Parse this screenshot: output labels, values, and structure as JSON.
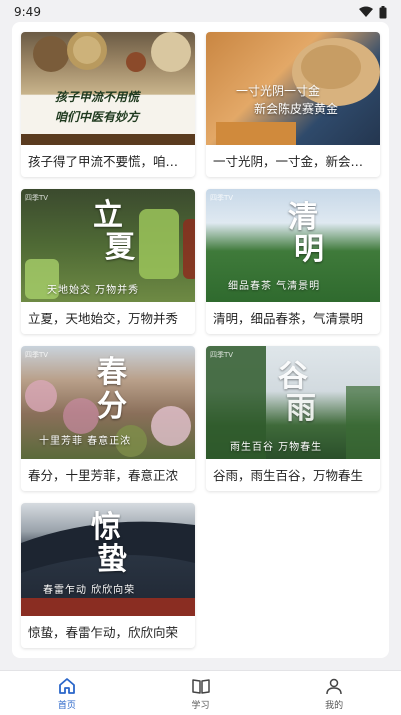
{
  "status": {
    "time": "9:49"
  },
  "cards": [
    {
      "title": "孩子得了甲流不要慌，咱们中医有妙方",
      "banner_line1": "孩子甲流不用慌",
      "banner_line2": "咱们中医有妙方"
    },
    {
      "title": "一寸光阴，一寸金，新会陈皮赛黄金",
      "banner_line1": "一寸光阴一寸金",
      "banner_line2": "新会陈皮赛黄金"
    },
    {
      "title": "立夏，天地始交，万物并秀",
      "char1": "立",
      "char2": "夏",
      "caption": "天地始交  万物并秀",
      "logo": "四季TV"
    },
    {
      "title": "清明，细品春茶，气清景明",
      "char1": "清",
      "char2": "明",
      "caption": "细品春茶  气清景明",
      "logo": "四季TV"
    },
    {
      "title": "春分，十里芳菲，春意正浓",
      "char1": "春",
      "char2": "分",
      "caption": "十里芳菲  春意正浓",
      "logo": "四季TV"
    },
    {
      "title": "谷雨，雨生百谷，万物春生",
      "char1": "谷",
      "char2": "雨",
      "caption": "雨生百谷  万物春生",
      "logo": "四季TV"
    },
    {
      "title": "惊蛰，春雷乍动，欣欣向荣",
      "char1": "惊",
      "char2": "蛰",
      "caption": "春雷乍动  欣欣向荣"
    }
  ],
  "nav": [
    {
      "label": "首页",
      "icon": "home-icon",
      "active": true
    },
    {
      "label": "学习",
      "icon": "book-icon",
      "active": false
    },
    {
      "label": "我的",
      "icon": "user-icon",
      "active": false
    }
  ],
  "colors": {
    "accent": "#2a66c9",
    "background": "#f1f1f3"
  }
}
